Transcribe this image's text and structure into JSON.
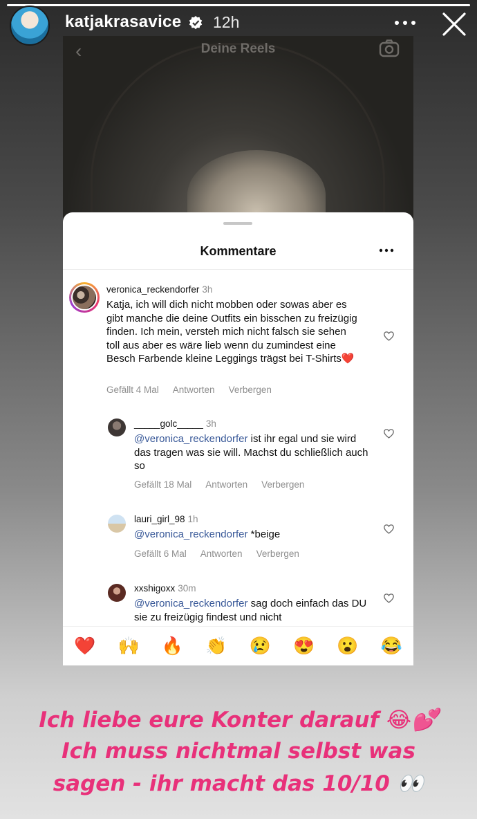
{
  "story": {
    "username": "katjakrasavice",
    "time": "12h",
    "progress": 1.0
  },
  "screenshot": {
    "header_title": "Deine Reels",
    "sheet_title": "Kommentare",
    "comments": [
      {
        "user": "veronica_reckendorfer",
        "time": "3h",
        "text": "Katja, ich will dich nicht mobben oder sowas aber es gibt manche die deine Outfits ein bisschen zu freizügig finden. Ich mein, versteh mich nicht falsch sie sehen toll aus aber es wäre lieb wenn du zumindest eine Besch Farbende kleine Leggings trägst bei T-Shirts❤️",
        "likes": "Gefällt 4 Mal",
        "reply": "Antworten",
        "hide": "Verbergen"
      },
      {
        "user": "_____golc_____",
        "time": "3h",
        "mention": "@veronica_reckendorfer",
        "text": " ist ihr egal und sie wird das tragen was sie will. Machst du schließlich auch so",
        "likes": "Gefällt 18 Mal",
        "reply": "Antworten",
        "hide": "Verbergen"
      },
      {
        "user": "lauri_girl_98",
        "time": "1h",
        "mention": "@veronica_reckendorfer",
        "text": " *beige",
        "likes": "Gefällt 6 Mal",
        "reply": "Antworten",
        "hide": "Verbergen"
      },
      {
        "user": "xxshigoxx",
        "time": "30m",
        "mention": "@veronica_reckendorfer",
        "text": " sag doch einfach das DU sie zu freizügig findest und nicht"
      }
    ],
    "reactions": [
      "❤️",
      "🙌",
      "🔥",
      "👏",
      "😢",
      "😍",
      "😮",
      "😂"
    ]
  },
  "caption": {
    "line1": "Ich liebe eure Konter darauf 😂💕",
    "line2": "Ich muss nichtmal selbst was",
    "line3": "sagen - ihr macht das 10/10 👀"
  },
  "colors": {
    "caption": "#e8317a",
    "mention": "#385898"
  },
  "icons": [
    "verified-icon",
    "more-icon",
    "close-icon",
    "back-icon",
    "camera-icon",
    "heart-icon"
  ]
}
